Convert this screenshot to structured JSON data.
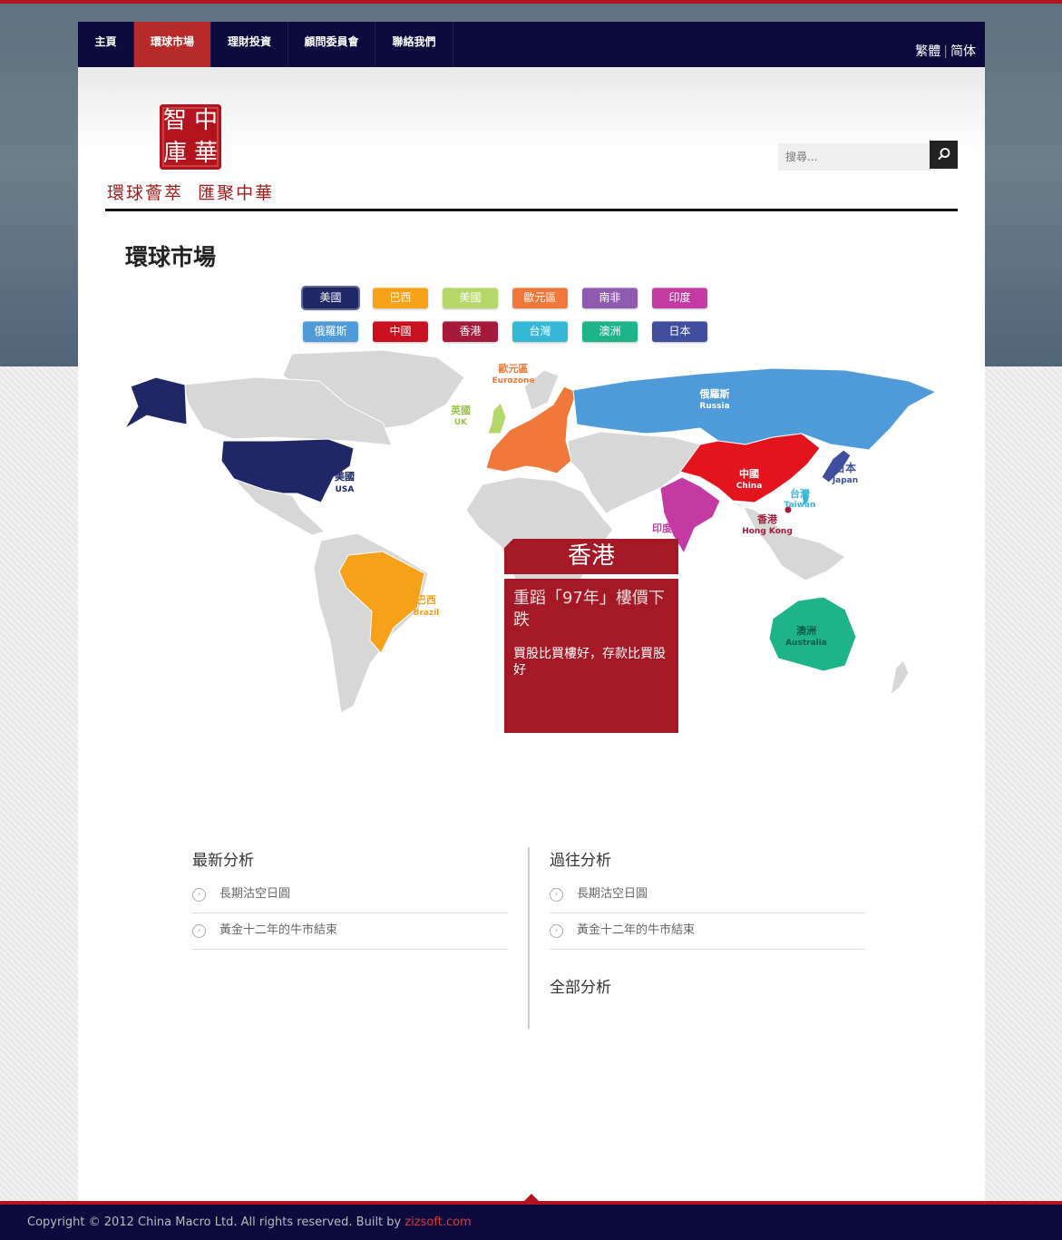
{
  "nav": {
    "items": [
      "主頁",
      "環球市場",
      "理財投資",
      "顧問委員會",
      "聯絡我們"
    ],
    "active_index": 1,
    "lang_trad": "繁體",
    "lang_simp": "简体"
  },
  "header": {
    "seal_chars": [
      "智",
      "中",
      "庫",
      "華"
    ],
    "tagline": "環球薈萃  匯聚中華",
    "search_placeholder": "搜尋..."
  },
  "page_title": "環球市場",
  "country_buttons": [
    {
      "label": "美國",
      "color": "#1f2766"
    },
    {
      "label": "巴西",
      "color": "#f6a118"
    },
    {
      "label": "美國",
      "color": "#b6d86a"
    },
    {
      "label": "歐元區",
      "color": "#f0783a"
    },
    {
      "label": "南非",
      "color": "#8e5bb0"
    },
    {
      "label": "印度",
      "color": "#c43aa3"
    },
    {
      "label": "俄羅斯",
      "color": "#4f9ad8"
    },
    {
      "label": "中國",
      "color": "#c8101e"
    },
    {
      "label": "香港",
      "color": "#a51a3a"
    },
    {
      "label": "台灣",
      "color": "#35b8d6"
    },
    {
      "label": "澳洲",
      "color": "#1fb38a"
    },
    {
      "label": "日本",
      "color": "#3f4f9e"
    }
  ],
  "map_labels": {
    "usa_zh": "美國",
    "usa_en": "USA",
    "brazil_zh": "巴西",
    "brazil_en": "Brazil",
    "uk_zh": "英國",
    "uk_en": "UK",
    "euro_zh": "歐元區",
    "euro_en": "Eurozone",
    "russia_zh": "俄羅斯",
    "russia_en": "Russia",
    "china_zh": "中國",
    "china_en": "China",
    "japan_zh": "日本",
    "japan_en": "Japan",
    "taiwan_zh": "台灣",
    "taiwan_en": "Taiwan",
    "hk_zh": "香港",
    "hk_en": "Hong Kong",
    "india_zh": "印度",
    "aus_zh": "澳洲",
    "aus_en": "Australia"
  },
  "tooltip": {
    "region": "香港",
    "title": "重蹈「97年」樓價下跌",
    "text": "買股比買樓好，存款比買股好"
  },
  "latest": {
    "title": "最新分析",
    "items": [
      "長期沽空日圓",
      "黃金十二年的牛市結束"
    ]
  },
  "past": {
    "title": "過往分析",
    "items": [
      "長期沽空日圓",
      "黃金十二年的牛市結束"
    ]
  },
  "all_analysis": "全部分析",
  "footer": {
    "copyright": "Copyright © 2012 China Macro Ltd. All rights reserved. Built by ",
    "builder": "zizsoft.com"
  },
  "colors": {
    "brand_red": "#b3131c",
    "nav_bg": "#0d0a3e",
    "land": "#d7d7d7"
  }
}
